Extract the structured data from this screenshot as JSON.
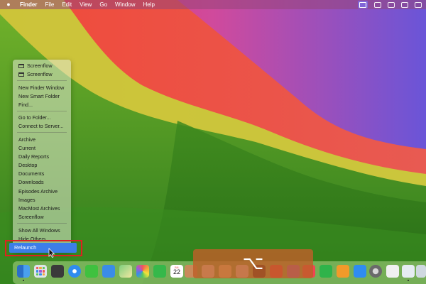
{
  "menubar": {
    "app_name": "Finder",
    "items": [
      "File",
      "Edit",
      "View",
      "Go",
      "Window",
      "Help"
    ],
    "icons": [
      "apple-icon",
      "screen-record-icon",
      "control-center-icon",
      "display-icon",
      "video-icon",
      "battery-icon"
    ]
  },
  "context_menu": {
    "window_items": [
      "Screenflow",
      "Screenflow"
    ],
    "new_items": [
      "New Finder Window",
      "New Smart Folder",
      "Find..."
    ],
    "go_items": [
      "Go to Folder...",
      "Connect to Server..."
    ],
    "folder_items": [
      "Archive",
      "Current",
      "Daily Reports",
      "Desktop",
      "Documents",
      "Downloads",
      "Episodes Archive",
      "Images",
      "MacMost Archives",
      "Screenflow"
    ],
    "show_all_windows": "Show All Windows",
    "hide_others": "Hide Others",
    "relaunch": "Relaunch"
  },
  "overlay": {
    "key_symbol": "⌥"
  },
  "dock": {
    "icons": [
      "finder-icon",
      "launchpad-icon",
      "calculator-icon",
      "safari-icon",
      "messages-icon",
      "mail-icon",
      "maps-icon",
      "photos-icon",
      "facetime-icon",
      "calendar-icon",
      "contacts-icon",
      "reminders-icon",
      "notes-icon",
      "freeform-icon",
      "tv-icon",
      "music-icon",
      "podcasts-icon",
      "news-icon",
      "numbers-icon",
      "pages-icon",
      "app-store-icon",
      "system-settings-icon",
      "script-editor-icon",
      "preview-icon"
    ],
    "calendar_day": "22",
    "calendar_month": "JUL",
    "accent_colors": {
      "finder": "#3a7fd8",
      "messages": "#3fc13f",
      "mail": "#3a8ce8",
      "facetime": "#35b84a",
      "music": "#f2364a",
      "news": "#f24452",
      "numbers": "#2fb34a",
      "pages": "#f29a2a",
      "app_store": "#2f8cf0"
    }
  }
}
